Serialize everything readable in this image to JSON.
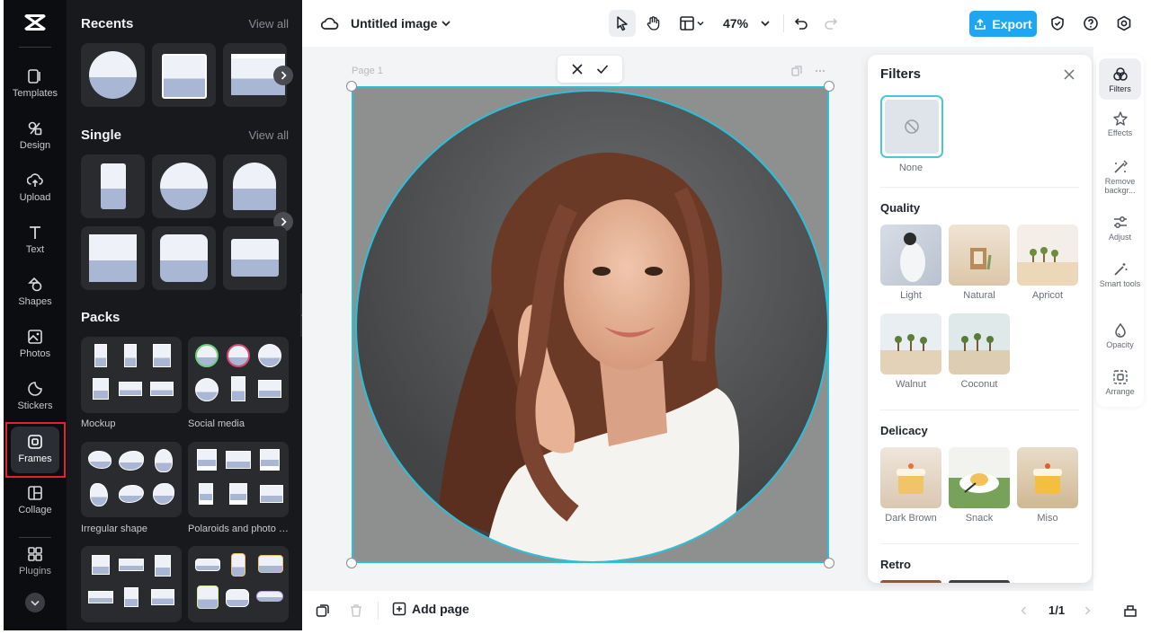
{
  "rail": {
    "items": [
      {
        "label": "Templates"
      },
      {
        "label": "Design"
      },
      {
        "label": "Upload"
      },
      {
        "label": "Text"
      },
      {
        "label": "Shapes"
      },
      {
        "label": "Photos"
      },
      {
        "label": "Stickers"
      },
      {
        "label": "Frames"
      },
      {
        "label": "Collage"
      },
      {
        "label": "Plugins"
      }
    ],
    "active": "Frames"
  },
  "panel": {
    "recents": {
      "title": "Recents",
      "view_all": "View all"
    },
    "single": {
      "title": "Single",
      "view_all": "View all"
    },
    "packs": {
      "title": "Packs",
      "items": [
        {
          "label": "Mockup"
        },
        {
          "label": "Social media"
        },
        {
          "label": "Irregular shape"
        },
        {
          "label": "Polaroids and photo f..."
        }
      ]
    }
  },
  "topbar": {
    "title": "Untitled image",
    "zoom": "47%",
    "export_label": "Export"
  },
  "canvas": {
    "page_label": "Page 1"
  },
  "bottombar": {
    "add_page": "Add page",
    "pager": "1/1"
  },
  "filters": {
    "title": "Filters",
    "none_label": "None",
    "sections": [
      {
        "title": "Quality",
        "items": [
          "Light",
          "Natural",
          "Apricot",
          "Walnut",
          "Coconut"
        ]
      },
      {
        "title": "Delicacy",
        "items": [
          "Dark Brown",
          "Snack",
          "Miso"
        ]
      },
      {
        "title": "Retro"
      }
    ]
  },
  "right_rail": {
    "items": [
      {
        "label": "Filters"
      },
      {
        "label": "Effects"
      },
      {
        "label": "Remove backgr..."
      },
      {
        "label": "Adjust"
      },
      {
        "label": "Smart tools"
      },
      {
        "label": "Opacity"
      },
      {
        "label": "Arrange"
      }
    ],
    "active": "Filters"
  },
  "colors": {
    "accent": "#1ea7f0",
    "selection": "#2bc0d8",
    "highlight": "#e0242f"
  }
}
